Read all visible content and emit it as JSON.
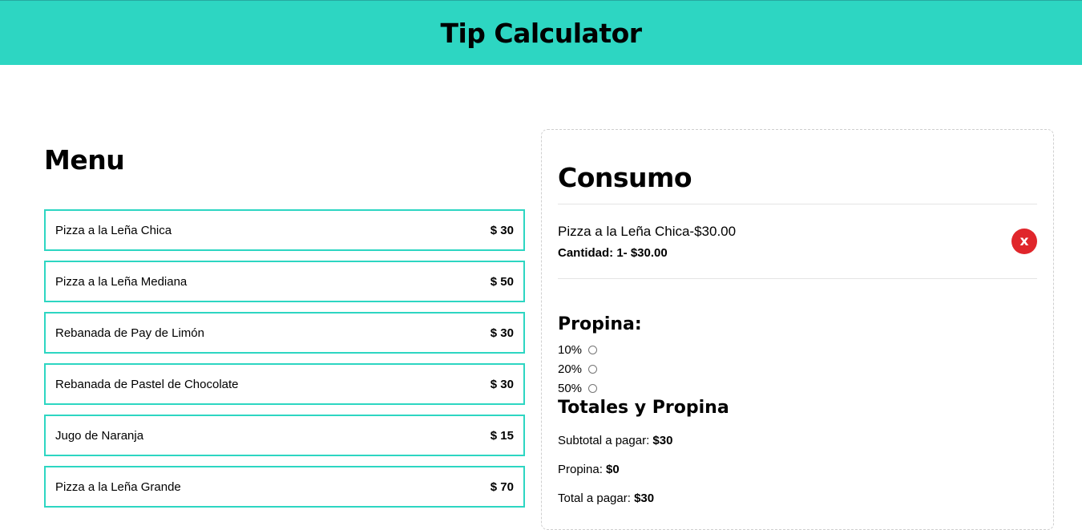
{
  "header": {
    "title": "Tip Calculator"
  },
  "menu": {
    "title": "Menu",
    "items": [
      {
        "name": "Pizza a la Leña Chica",
        "price": "$ 30"
      },
      {
        "name": "Pizza a la Leña Mediana",
        "price": "$ 50"
      },
      {
        "name": "Rebanada de Pay de Limón",
        "price": "$ 30"
      },
      {
        "name": "Rebanada de Pastel de Chocolate",
        "price": "$ 30"
      },
      {
        "name": "Jugo de Naranja",
        "price": "$ 15"
      },
      {
        "name": "Pizza a la Leña Grande",
        "price": "$ 70"
      }
    ]
  },
  "consumo": {
    "title": "Consumo",
    "order": {
      "name": "Pizza a la Leña Chica-$30.00",
      "quantity": "Cantidad: 1- $30.00",
      "remove_label": "x"
    },
    "propina": {
      "title": "Propina:",
      "options": [
        "10%",
        "20%",
        "50%"
      ]
    },
    "totales": {
      "title": "Totales y Propina",
      "subtotal_label": "Subtotal a pagar:",
      "subtotal_value": "$30",
      "propina_label": "Propina:",
      "propina_value": "$0",
      "total_label": "Total a pagar:",
      "total_value": "$30"
    }
  },
  "colors": {
    "accent": "#2dd6c2",
    "remove": "#e0262b"
  }
}
